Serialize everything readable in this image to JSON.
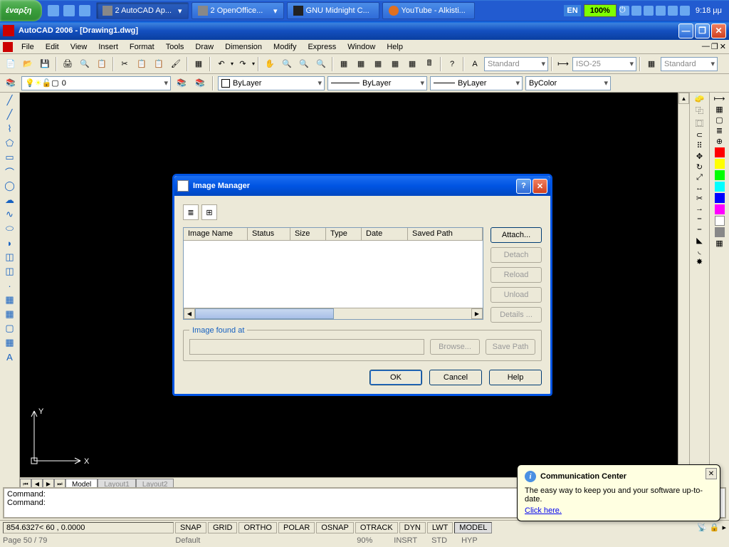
{
  "taskbar": {
    "start": "έναρξη",
    "items": [
      {
        "label": "2 AutoCAD Ap...",
        "active": true
      },
      {
        "label": "2 OpenOffice...",
        "active": false
      },
      {
        "label": "GNU Midnight C...",
        "active": false
      },
      {
        "label": "YouTube - Alkisti...",
        "active": false
      }
    ],
    "lang": "EN",
    "battery": "100%",
    "clock": "9:18 μμ"
  },
  "app": {
    "title": "AutoCAD 2006 - [Drawing1.dwg]"
  },
  "menu": [
    "File",
    "Edit",
    "View",
    "Insert",
    "Format",
    "Tools",
    "Draw",
    "Dimension",
    "Modify",
    "Express",
    "Window",
    "Help"
  ],
  "toolbar_selects": {
    "style": "Standard",
    "dimstyle": "ISO-25",
    "table": "Standard"
  },
  "layer": {
    "current": "0",
    "bylayer1": "ByLayer",
    "bylayer2": "ByLayer",
    "bylayer3": "ByLayer",
    "bycolor": "ByColor"
  },
  "tabs": {
    "model": "Model",
    "layout1": "Layout1",
    "layout2": "Layout2"
  },
  "command": {
    "l1": "Command:",
    "l2": "Command:"
  },
  "status": {
    "coords": "854.6327< 60    , 0.0000",
    "btns": [
      "SNAP",
      "GRID",
      "ORTHO",
      "POLAR",
      "OSNAP",
      "OTRACK",
      "DYN",
      "LWT",
      "MODEL"
    ]
  },
  "status2": {
    "page": "Page 50 / 79",
    "default": "Default",
    "pct": "90%",
    "insrt": "INSRT",
    "std": "STD",
    "hyp": "HYP"
  },
  "dialog": {
    "title": "Image Manager",
    "headers": [
      "Image Name",
      "Status",
      "Size",
      "Type",
      "Date",
      "Saved Path"
    ],
    "buttons": {
      "attach": "Attach...",
      "detach": "Detach",
      "reload": "Reload",
      "unload": "Unload",
      "details": "Details ..."
    },
    "found_label": "Image found at",
    "browse": "Browse...",
    "save_path": "Save Path",
    "ok": "OK",
    "cancel": "Cancel",
    "help": "Help"
  },
  "balloon": {
    "title": "Communication Center",
    "text": "The easy way to keep you and your software up-to-date.",
    "link": "Click here."
  },
  "ucs": {
    "x": "X",
    "y": "Y"
  }
}
